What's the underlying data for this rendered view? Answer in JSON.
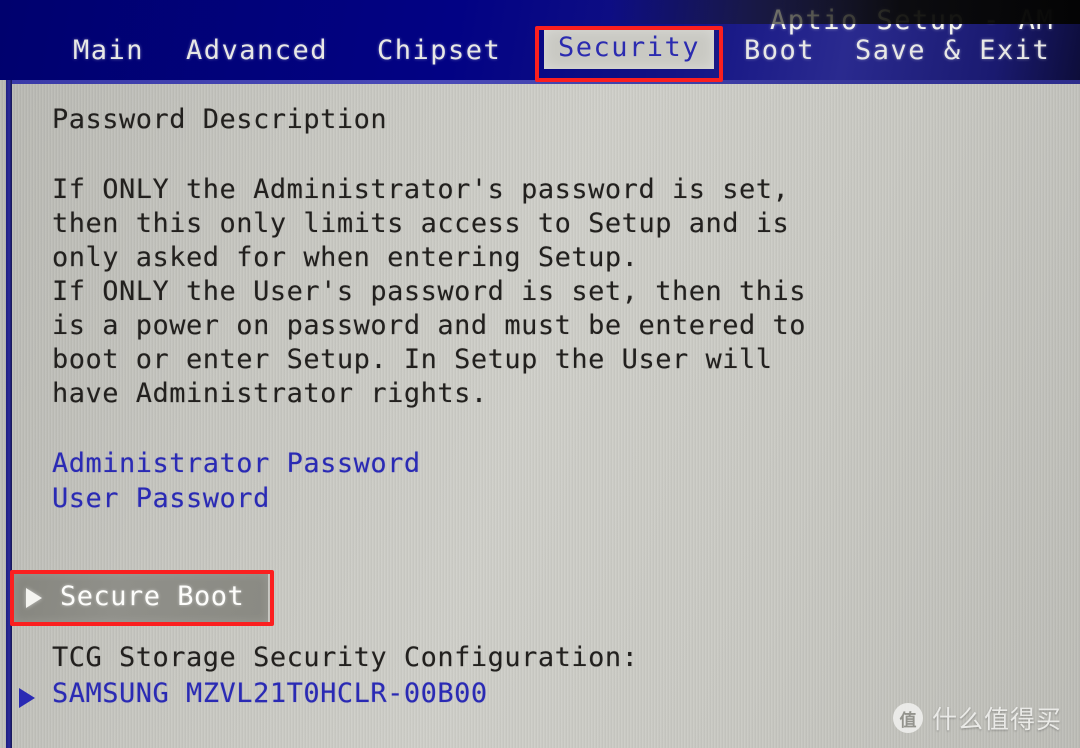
{
  "app": {
    "title": "Aptio Setup - AM",
    "vendor_note_cut_off": true
  },
  "menubar": {
    "tabs": [
      {
        "id": "main",
        "label": "Main",
        "active": false
      },
      {
        "id": "advanced",
        "label": "Advanced",
        "active": false
      },
      {
        "id": "chipset",
        "label": "Chipset",
        "active": false
      },
      {
        "id": "security",
        "label": "Security",
        "active": true
      },
      {
        "id": "boot",
        "label": "Boot",
        "active": false
      },
      {
        "id": "save",
        "label": "Save & Exit",
        "active": false
      }
    ]
  },
  "main": {
    "section_heading": "Password Description",
    "description_lines": [
      "If ONLY the Administrator's password is set,",
      "then this only limits access to Setup and is",
      "only asked for when entering Setup.",
      "If ONLY the User's password is set, then this",
      "is a power on password and must be entered to",
      "boot or enter Setup. In Setup the User will",
      "have Administrator rights."
    ],
    "password_items": [
      {
        "label": "Administrator Password"
      },
      {
        "label": "User Password"
      }
    ],
    "selected_item": {
      "label": "Secure Boot",
      "arrow": "right-triangle",
      "selected": true
    },
    "tcg_heading": "TCG Storage Security Configuration:",
    "tcg_items": [
      {
        "label": "SAMSUNG MZVL21T0HCLR-00B00",
        "arrow": "right-triangle"
      }
    ]
  },
  "annotations": [
    {
      "id": "security-tab-box",
      "target": "Security",
      "color": "#fb1f1f"
    },
    {
      "id": "secure-boot-box",
      "target": "Secure Boot",
      "color": "#fb1f1f"
    }
  ],
  "watermark": {
    "logo_char": "值",
    "text": "什么值得买"
  },
  "colors": {
    "menubar_blue": "#000080",
    "panel_gray": "#c9c9c3",
    "text_dark": "#22201e",
    "text_blue": "#2a2ab4",
    "highlight_gray": "#8a8a83",
    "highlight_text": "#fdfdfb",
    "annotation_red": "#fb1f1f"
  }
}
